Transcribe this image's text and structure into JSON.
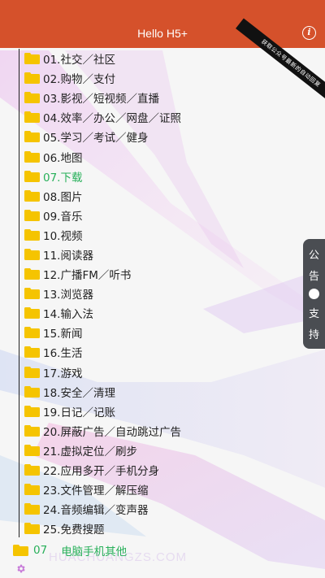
{
  "header": {
    "title": "Hello H5+",
    "info_icon": "i"
  },
  "ribbon": {
    "text": "获取公众号最新的自动回复"
  },
  "colors": {
    "header_bg": "#d5512b",
    "folder": "#f5c400",
    "active": "#28b05a"
  },
  "folders": [
    {
      "label": "01.社交／社区"
    },
    {
      "label": "02.购物／支付"
    },
    {
      "label": "03.影视／短视频／直播"
    },
    {
      "label": "04.效率／办公／网盘／证照"
    },
    {
      "label": "05.学习／考试／健身"
    },
    {
      "label": "06.地图"
    },
    {
      "label": "07.下载"
    },
    {
      "label": "08.图片"
    },
    {
      "label": "09.音乐"
    },
    {
      "label": "10.视频"
    },
    {
      "label": "11.阅读器"
    },
    {
      "label": "12.广播FM／听书"
    },
    {
      "label": "13.浏览器"
    },
    {
      "label": "14.输入法"
    },
    {
      "label": "15.新闻"
    },
    {
      "label": "16.生活"
    },
    {
      "label": "17.游戏"
    },
    {
      "label": "18.安全／清理"
    },
    {
      "label": "19.日记／记账"
    },
    {
      "label": "20.屏蔽广告／自动跳过广告"
    },
    {
      "label": "21.虚拟定位／刷步"
    },
    {
      "label": "22.应用多开／手机分身"
    },
    {
      "label": "23.文件管理／解压缩"
    },
    {
      "label": "24.音频编辑／变声器"
    },
    {
      "label": "25.免费搜题"
    }
  ],
  "active_index": 6,
  "footer": {
    "number": "07",
    "label": "电脑手机其他"
  },
  "side_panel": {
    "top_label_1": "公",
    "top_label_2": "告",
    "bottom_label_1": "支",
    "bottom_label_2": "持"
  },
  "watermark": "HUACHUANGZS.COM"
}
